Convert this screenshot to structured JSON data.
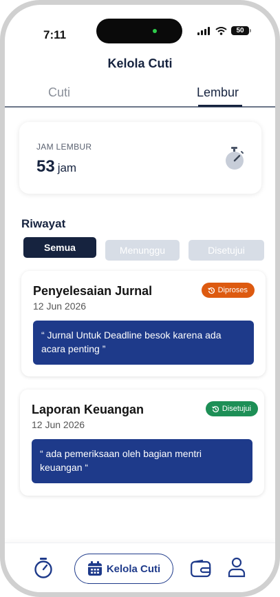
{
  "status_bar": {
    "time": "7:11",
    "battery": "50"
  },
  "header": {
    "title": "Kelola Cuti"
  },
  "tabs": [
    {
      "label": "Cuti",
      "active": false
    },
    {
      "label": "Lembur",
      "active": true
    }
  ],
  "overtime_summary": {
    "label": "JAM LEMBUR",
    "value": "53",
    "unit": "jam",
    "icon": "stopwatch-icon"
  },
  "history": {
    "title": "Riwayat",
    "filters": [
      {
        "label": "Semua",
        "active": true
      },
      {
        "label": "Menunggu",
        "active": false
      },
      {
        "label": "Disetujui",
        "active": false
      }
    ],
    "items": [
      {
        "title": "Penyelesaian Jurnal",
        "date": "12 Jun 2026",
        "status": "Diproses",
        "status_color": "#dd5a10",
        "note": "“ Jurnal Untuk Deadline besok karena ada acara penting ”"
      },
      {
        "title": "Laporan Keuangan",
        "date": "12 Jun 2026",
        "status": "Disetujui",
        "status_color": "#1d8f56",
        "note": "“ ada pemeriksaan oleh bagian mentri keuangan “"
      }
    ]
  },
  "bottom_nav": {
    "items": [
      {
        "icon": "stopwatch-icon"
      },
      {
        "icon": "calendar-icon",
        "label": "Kelola Cuti",
        "active": true
      },
      {
        "icon": "wallet-icon"
      },
      {
        "icon": "profile-icon"
      }
    ]
  },
  "colors": {
    "primary": "#16233f",
    "accent": "#1e3a8a",
    "inactive_filter": "#d7dde6"
  }
}
